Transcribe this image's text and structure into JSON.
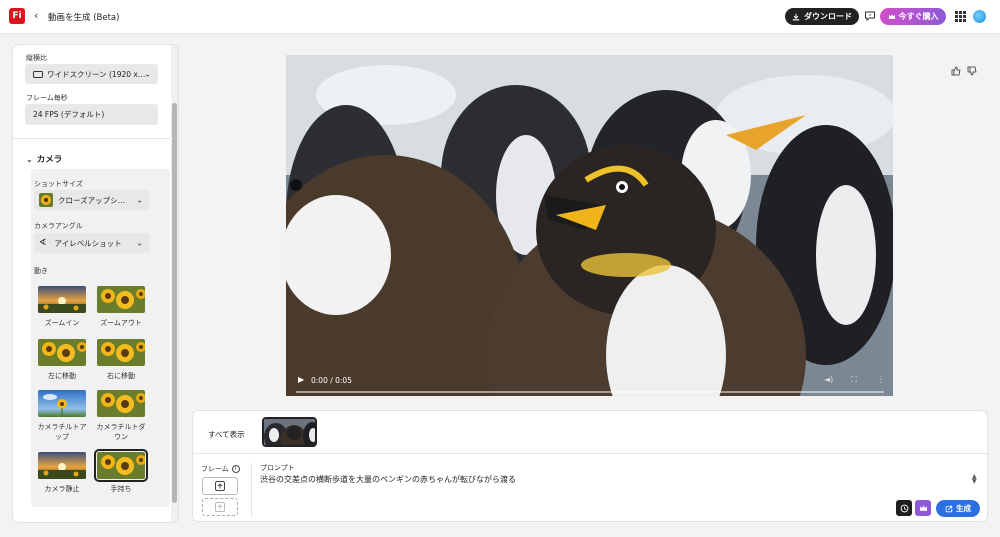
{
  "app": {
    "logo_text": "Fi",
    "title": "動画を生成 (Beta)",
    "download_label": "ダウンロード",
    "buy_label": "今すぐ購入"
  },
  "settings": {
    "aspect_label": "縦横比",
    "aspect_value": "ワイドスクリーン (1920 x…",
    "fps_label": "フレーム毎秒",
    "fps_value": "24 FPS (デフォルト)"
  },
  "camera": {
    "section_title": "カメラ",
    "shot_size_label": "ショットサイズ",
    "shot_size_value": "クローズアップシ…",
    "angle_label": "カメラアングル",
    "angle_value": "アイレベルショット",
    "motion_label": "動き",
    "motions": [
      {
        "label": "ズームイン",
        "thumb": "sunset"
      },
      {
        "label": "ズームアウト",
        "thumb": "sunflower"
      },
      {
        "label": "左に移動",
        "thumb": "sunflower"
      },
      {
        "label": "右に移動",
        "thumb": "sunflower"
      },
      {
        "label": "カメラチルトアップ",
        "thumb": "sky"
      },
      {
        "label": "カメラチルトダウン",
        "thumb": "sunflower"
      },
      {
        "label": "カメラ静止",
        "thumb": "sunset"
      },
      {
        "label": "手持ち",
        "thumb": "sunflower",
        "selected": true
      }
    ]
  },
  "video": {
    "time": "0:00 / 0:05",
    "progress": 0
  },
  "bottom": {
    "show_all_label": "すべて表示",
    "frame_label": "フレーム",
    "prompt_label": "プロンプト",
    "prompt_value": "渋谷の交差点の横断歩道を大量のペンギンの赤ちゃんが転びながら渡る",
    "generate_label": "生成"
  },
  "colors": {
    "accent": "#2b6fe0",
    "brand": "#d8161b",
    "premium_start": "#cf4fc9",
    "premium_end": "#8e5ad8"
  }
}
